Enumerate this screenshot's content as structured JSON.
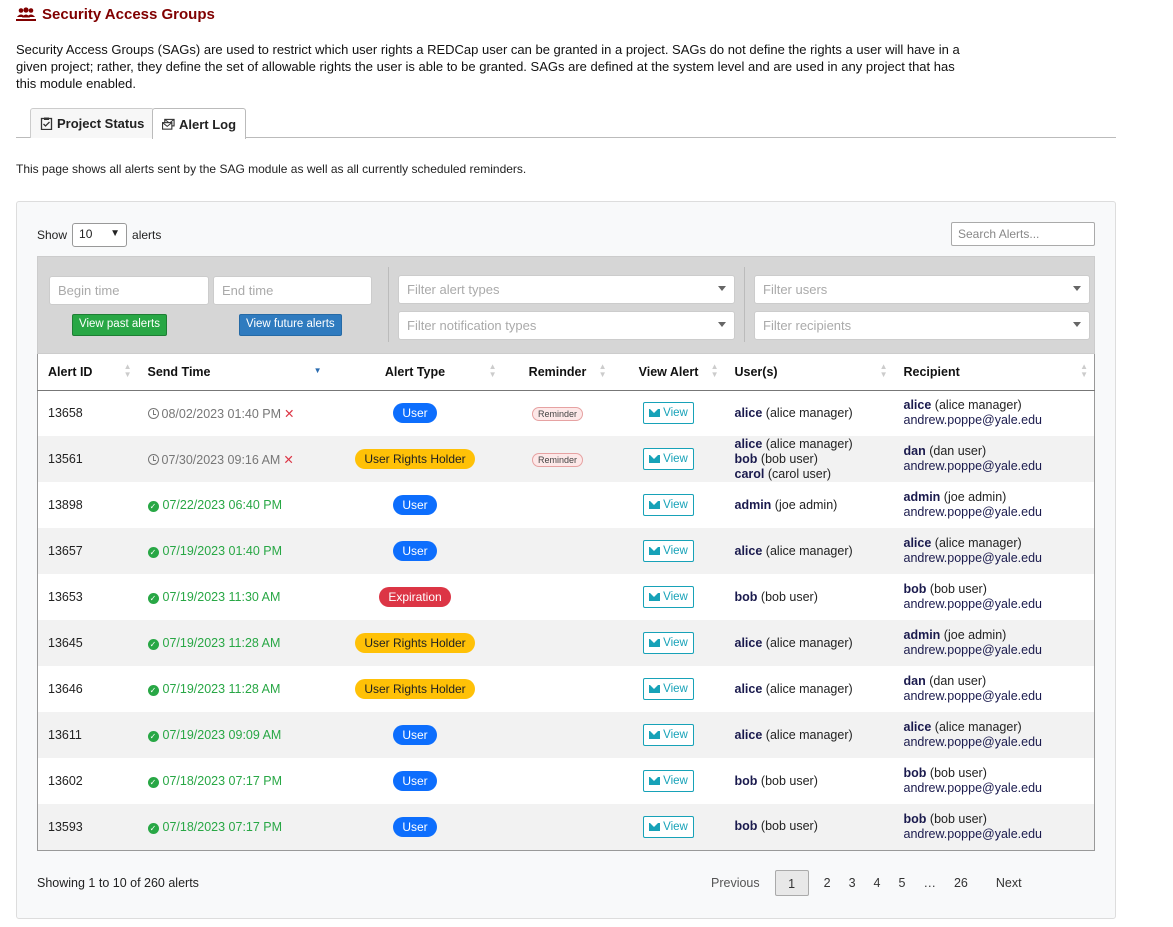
{
  "header": {
    "title": "Security Access Groups",
    "description": "Security Access Groups (SAGs) are used to restrict which user rights a REDCap user can be granted in a project. SAGs do not define the rights a user will have in a given project; rather, they define the set of allowable rights the user is able to be granted. SAGs are defined at the system level and are used in any project that has this module enabled."
  },
  "tabs": [
    {
      "label": "Project Status",
      "icon": "clipboard-icon",
      "active": false
    },
    {
      "label": "Alert Log",
      "icon": "envelopes-icon",
      "active": true
    }
  ],
  "intro": "This page shows all alerts sent by the SAG module as well as all currently scheduled reminders.",
  "controls": {
    "show_label": "Show",
    "page_size": "10",
    "alerts_label": "alerts",
    "search_placeholder": "Search Alerts..."
  },
  "filters": {
    "begin_time_placeholder": "Begin time",
    "end_time_placeholder": "End time",
    "past_button": "View past alerts",
    "future_button": "View future alerts",
    "alert_types_placeholder": "Filter alert types",
    "notification_types_placeholder": "Filter notification types",
    "users_placeholder": "Filter users",
    "recipients_placeholder": "Filter recipients"
  },
  "table": {
    "columns": [
      "Alert ID",
      "Send Time",
      "Alert Type",
      "Reminder",
      "View Alert",
      "User(s)",
      "Recipient"
    ],
    "view_label": "View",
    "rows": [
      {
        "id": "13658",
        "time": "08/02/2023 01:40 PM",
        "scheduled": true,
        "type": "User",
        "reminder": "Reminder",
        "users": [
          {
            "u": "alice",
            "n": "(alice manager)"
          }
        ],
        "rec_u": "alice",
        "rec_n": "(alice manager)",
        "email": "andrew.poppe@yale.edu"
      },
      {
        "id": "13561",
        "time": "07/30/2023 09:16 AM",
        "scheduled": true,
        "type": "User Rights Holder",
        "reminder": "Reminder",
        "users": [
          {
            "u": "alice",
            "n": "(alice manager)"
          },
          {
            "u": "bob",
            "n": "(bob user)"
          },
          {
            "u": "carol",
            "n": "(carol user)"
          }
        ],
        "rec_u": "dan",
        "rec_n": "(dan user)",
        "email": "andrew.poppe@yale.edu"
      },
      {
        "id": "13898",
        "time": "07/22/2023 06:40 PM",
        "scheduled": false,
        "type": "User",
        "reminder": "",
        "users": [
          {
            "u": "admin",
            "n": "(joe admin)"
          }
        ],
        "rec_u": "admin",
        "rec_n": "(joe admin)",
        "email": "andrew.poppe@yale.edu"
      },
      {
        "id": "13657",
        "time": "07/19/2023 01:40 PM",
        "scheduled": false,
        "type": "User",
        "reminder": "",
        "users": [
          {
            "u": "alice",
            "n": "(alice manager)"
          }
        ],
        "rec_u": "alice",
        "rec_n": "(alice manager)",
        "email": "andrew.poppe@yale.edu"
      },
      {
        "id": "13653",
        "time": "07/19/2023 11:30 AM",
        "scheduled": false,
        "type": "Expiration",
        "reminder": "",
        "users": [
          {
            "u": "bob",
            "n": "(bob user)"
          }
        ],
        "rec_u": "bob",
        "rec_n": "(bob user)",
        "email": "andrew.poppe@yale.edu"
      },
      {
        "id": "13645",
        "time": "07/19/2023 11:28 AM",
        "scheduled": false,
        "type": "User Rights Holder",
        "reminder": "",
        "users": [
          {
            "u": "alice",
            "n": "(alice manager)"
          }
        ],
        "rec_u": "admin",
        "rec_n": "(joe admin)",
        "email": "andrew.poppe@yale.edu"
      },
      {
        "id": "13646",
        "time": "07/19/2023 11:28 AM",
        "scheduled": false,
        "type": "User Rights Holder",
        "reminder": "",
        "users": [
          {
            "u": "alice",
            "n": "(alice manager)"
          }
        ],
        "rec_u": "dan",
        "rec_n": "(dan user)",
        "email": "andrew.poppe@yale.edu"
      },
      {
        "id": "13611",
        "time": "07/19/2023 09:09 AM",
        "scheduled": false,
        "type": "User",
        "reminder": "",
        "users": [
          {
            "u": "alice",
            "n": "(alice manager)"
          }
        ],
        "rec_u": "alice",
        "rec_n": "(alice manager)",
        "email": "andrew.poppe@yale.edu"
      },
      {
        "id": "13602",
        "time": "07/18/2023 07:17 PM",
        "scheduled": false,
        "type": "User",
        "reminder": "",
        "users": [
          {
            "u": "bob",
            "n": "(bob user)"
          }
        ],
        "rec_u": "bob",
        "rec_n": "(bob user)",
        "email": "andrew.poppe@yale.edu"
      },
      {
        "id": "13593",
        "time": "07/18/2023 07:17 PM",
        "scheduled": false,
        "type": "User",
        "reminder": "",
        "users": [
          {
            "u": "bob",
            "n": "(bob user)"
          }
        ],
        "rec_u": "bob",
        "rec_n": "(bob user)",
        "email": "andrew.poppe@yale.edu"
      }
    ]
  },
  "footer": {
    "info": "Showing 1 to 10 of 260 alerts",
    "pages": [
      "Previous",
      "1",
      "2",
      "3",
      "4",
      "5",
      "…",
      "26",
      "Next"
    ],
    "current_page": "1"
  },
  "colors": {
    "title": "#800000",
    "user_badge": "#0d6efd",
    "holder_badge": "#ffc107",
    "expiration_badge": "#dc3545",
    "sent_time": "#28a745"
  }
}
